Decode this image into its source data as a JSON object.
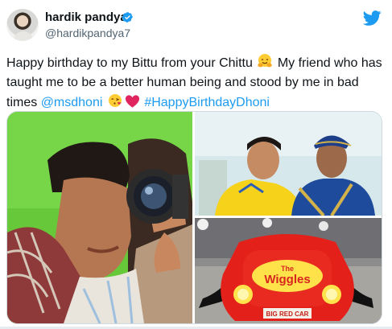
{
  "tweet": {
    "author": {
      "name": "hardik pandya",
      "handle": "@hardikpandya7"
    },
    "text_parts": {
      "line1": "Happy birthday to my Bittu from your Chittu",
      "line2": "My friend who has taught me to be a better human being and stood by me in bad times",
      "mention": "@msdhoni",
      "hashtag": "#HappyBirthdayDhoni"
    },
    "media": {
      "car_logo": "The Wiggles",
      "car_plate": "BIG RED CAR"
    },
    "icons": {
      "verified": "verified-badge-icon",
      "twitter": "twitter-bird-icon",
      "hug": "hugging-face-emoji",
      "kiss": "kiss-face-emoji",
      "heart": "red-heart-emoji"
    },
    "colors": {
      "link": "#1d9bf0",
      "verified": "#1d9bf0",
      "text": "#0f1419",
      "secondary": "#536471"
    }
  }
}
